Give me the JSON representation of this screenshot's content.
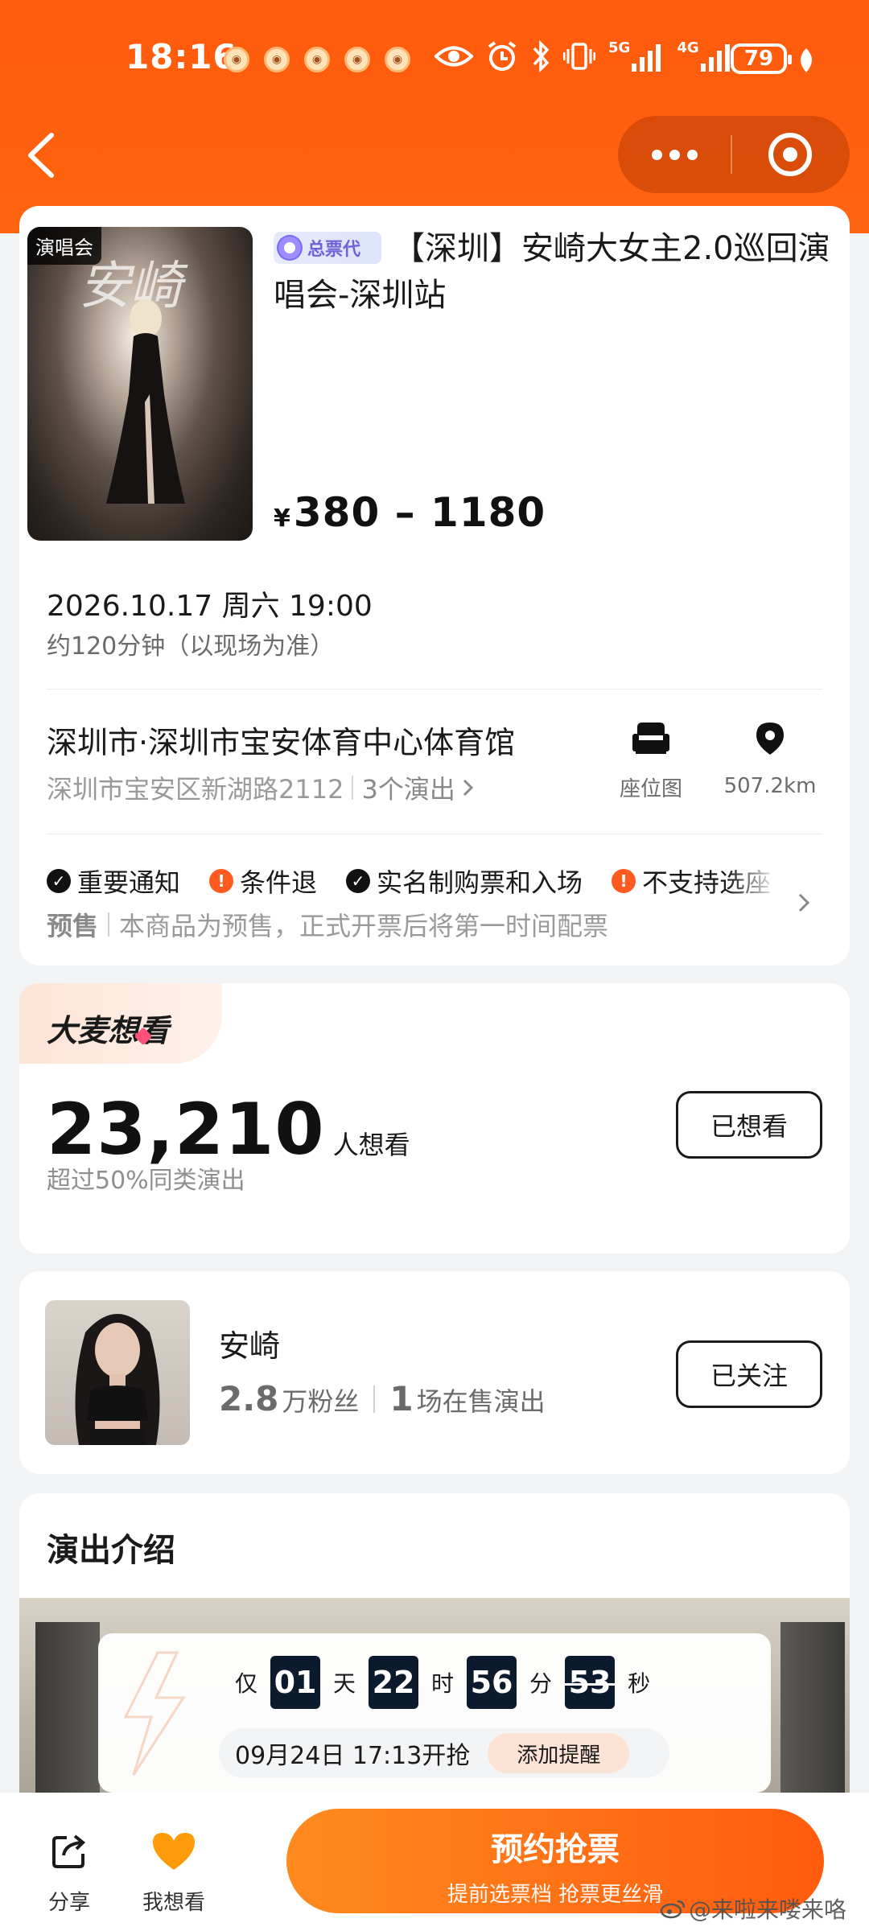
{
  "status_bar": {
    "time": "18:16",
    "network_1": "5G",
    "network_2": "4G",
    "battery": "79"
  },
  "nav": {
    "back_icon": "chevron-left-icon",
    "more_icon": "more-dots-icon",
    "close_icon": "target-close-icon"
  },
  "show": {
    "poster_tag": "演唱会",
    "agent_badge": "总票代",
    "title": "【深圳】安崎大女主2.0巡回演唱会-深圳站",
    "price_currency": "¥",
    "price_range": "380 – 1180",
    "datetime": "2026.10.17 周六 19:00",
    "duration": "约120分钟（以现场为准）",
    "venue": "深圳市·深圳市宝安体育中心体育馆",
    "address": "深圳市宝安区新湖路2112",
    "show_count": "3个演出",
    "seat_map_label": "座位图",
    "distance": "507.2km",
    "notices": [
      {
        "label": "重要通知",
        "type": "ok"
      },
      {
        "label": "条件退",
        "type": "warn"
      },
      {
        "label": "实名制购票和入场",
        "type": "ok"
      },
      {
        "label": "不支持选座",
        "type": "warn"
      }
    ],
    "presale_tag": "预售",
    "presale_text": "本商品为预售，正式开票后将第一时间配票"
  },
  "want": {
    "tag": "大麦想看",
    "count": "23,210",
    "count_unit": "人想看",
    "sub": "超过50%同类演出",
    "button": "已想看"
  },
  "artist": {
    "name": "安崎",
    "fans_num": "2.8",
    "fans_unit": "万粉丝",
    "shows_num": "1",
    "shows_unit": "场在售演出",
    "button": "已关注"
  },
  "intro": {
    "title": "演出介绍",
    "countdown": {
      "prefix": "仅",
      "days": "01",
      "days_unit": "天",
      "hours": "22",
      "hours_unit": "时",
      "minutes": "56",
      "minutes_unit": "分",
      "seconds": "53",
      "seconds_unit": "秒",
      "open_time": "09月24日 17:13开抢",
      "remind_button": "添加提醒"
    }
  },
  "bottom": {
    "share_label": "分享",
    "want_label": "我想看",
    "buy_main": "预约抢票",
    "buy_sub": "提前选票档 抢票更丝滑"
  },
  "watermark": "@来啦来喽来咯",
  "colors": {
    "brand_orange": "#ff5a0d",
    "cta_gradient_start": "#ff8a1e",
    "cta_gradient_end": "#ff5b0f",
    "countdown_block": "#0c1a2e",
    "warn": "#ff5a1f",
    "heart": "#ff8a00"
  }
}
